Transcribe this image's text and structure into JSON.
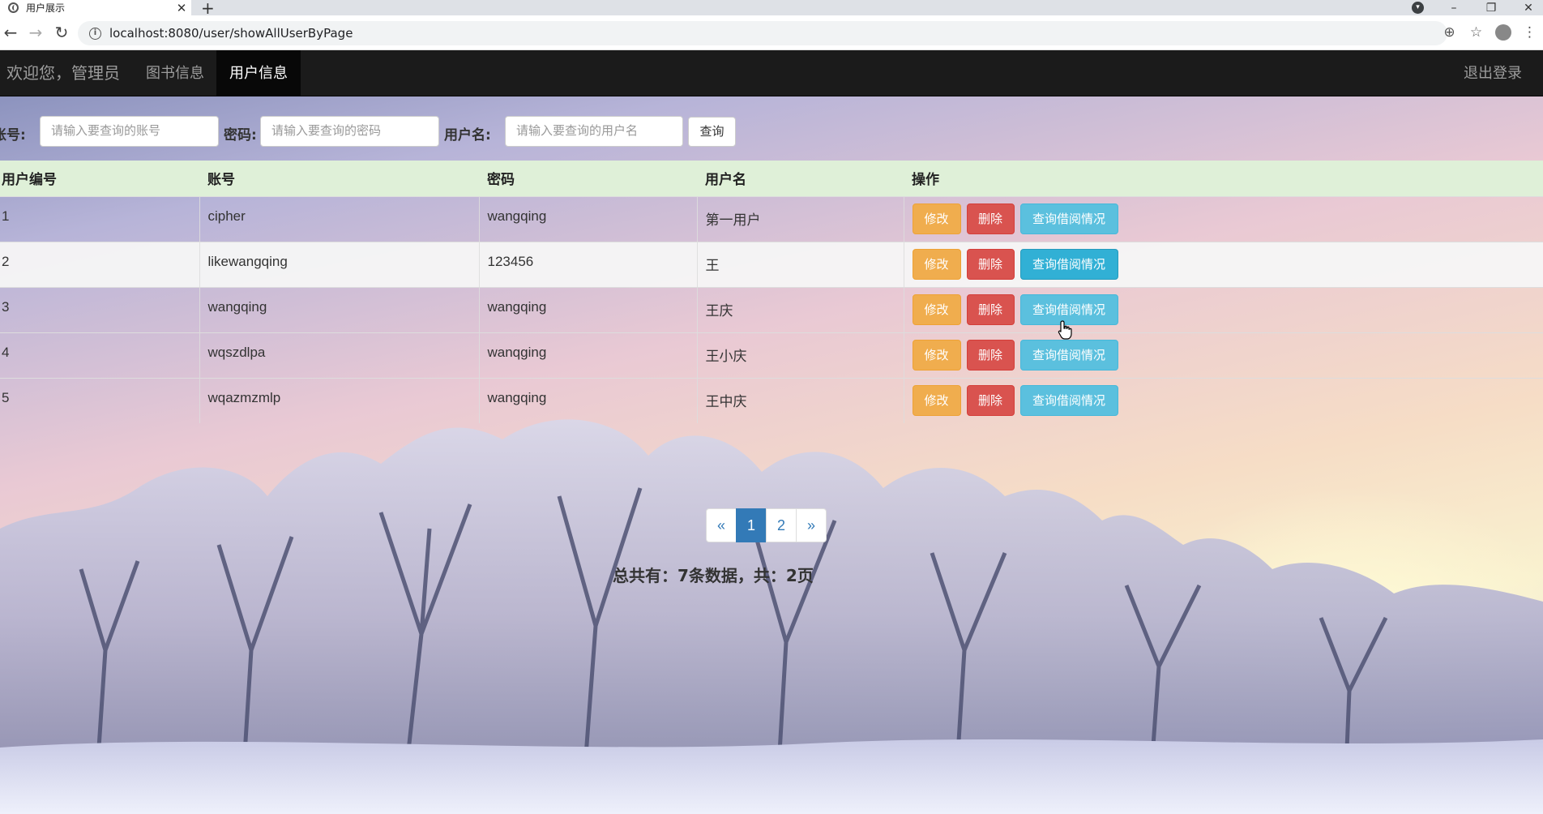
{
  "browser": {
    "tab_title": "用户展示",
    "tab_close": "✕",
    "new_tab": "+",
    "url": "localhost:8080/user/showAllUserByPage"
  },
  "navbar": {
    "brand": "欢迎您，管理员",
    "links": [
      {
        "label": "图书信息",
        "active": false
      },
      {
        "label": "用户信息",
        "active": true
      }
    ],
    "logout": "退出登录"
  },
  "search": {
    "account_label": "账号:",
    "account_placeholder": "请输入要查询的账号",
    "password_label": "密码:",
    "password_placeholder": "请输入要查询的密码",
    "username_label": "用户名:",
    "username_placeholder": "请输入要查询的用户名",
    "query_button": "查询"
  },
  "table": {
    "headers": [
      "用户编号",
      "账号",
      "密码",
      "用户名",
      "操作"
    ],
    "rows": [
      {
        "id": "1",
        "account": "cipher",
        "password": "wangqing",
        "username": "第一用户"
      },
      {
        "id": "2",
        "account": "likewangqing",
        "password": "123456",
        "username": "王"
      },
      {
        "id": "3",
        "account": "wangqing",
        "password": "wangqing",
        "username": "王庆"
      },
      {
        "id": "4",
        "account": "wqszdlpa",
        "password": "wanqging",
        "username": "王小庆"
      },
      {
        "id": "5",
        "account": "wqazmzmlp",
        "password": "wangqing",
        "username": "王中庆"
      }
    ],
    "actions": {
      "edit": "修改",
      "delete": "删除",
      "view_borrow": "查询借阅情况"
    }
  },
  "pagination": {
    "prev": "«",
    "pages": [
      "1",
      "2"
    ],
    "current_page": "1",
    "next": "»"
  },
  "summary": "总共有：7条数据，共：2页",
  "colors": {
    "navbar_bg": "#1b1b1b",
    "header_row": "#dff0d8",
    "edit_button": "#f0ad4e",
    "delete_button": "#d9534f",
    "view_button": "#5bc0de",
    "pager_active": "#337ab7"
  }
}
